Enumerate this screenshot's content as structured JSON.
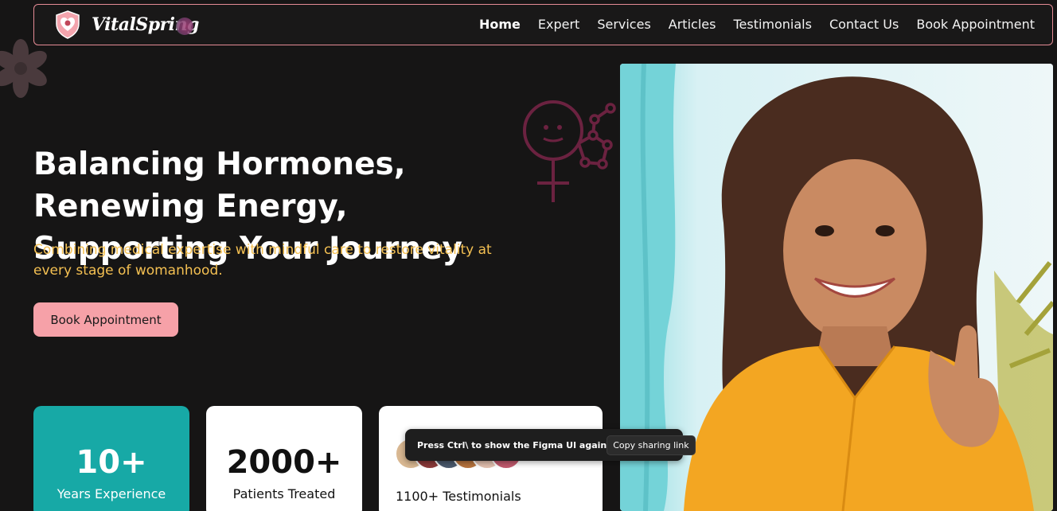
{
  "brand": {
    "name": "VitalSpring"
  },
  "nav": {
    "items": [
      {
        "label": "Home",
        "active": true
      },
      {
        "label": "Expert"
      },
      {
        "label": "Services"
      },
      {
        "label": "Articles"
      },
      {
        "label": "Testimonials"
      },
      {
        "label": "Contact Us"
      },
      {
        "label": "Book Appointment"
      }
    ]
  },
  "hero": {
    "title": "Balancing Hormones, Renewing Energy, Supporting Your Journey",
    "subtitle": "Combining medical expertise with mindful care to restore vitality at every stage of womanhood.",
    "cta_label": "Book Appointment"
  },
  "stats": [
    {
      "value": "10+",
      "label": "Years Experience"
    },
    {
      "value": "2000+",
      "label": "Patients Treated"
    },
    {
      "label": "1100+ Testimonials"
    }
  ],
  "toast": {
    "message": "Press Ctrl\\ to show the Figma UI again",
    "button_label": "Copy sharing link"
  },
  "colors": {
    "background": "#161515",
    "accent_pink": "#f6a1a8",
    "accent_yellow": "#f4c052",
    "accent_teal": "#17a9a6",
    "nav_border": "#e58b95"
  }
}
